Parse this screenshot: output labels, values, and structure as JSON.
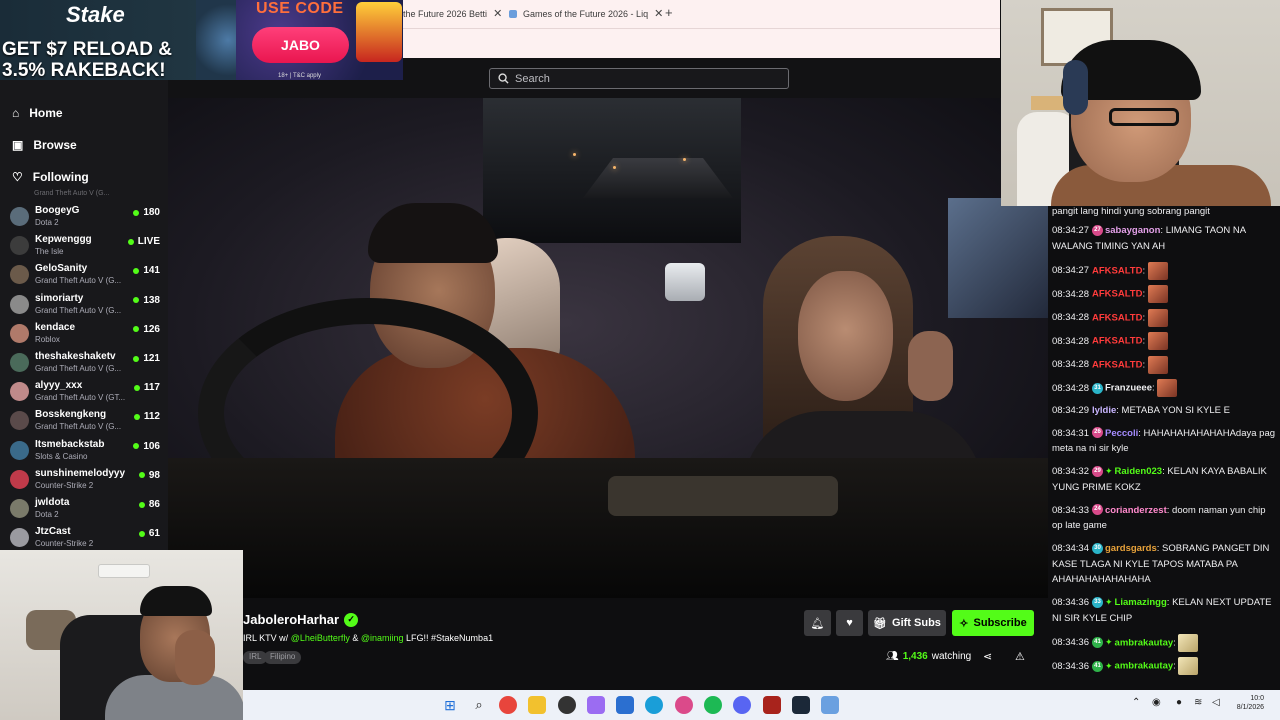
{
  "browser": {
    "tabs": [
      {
        "label": "the Future 2026 Betti"
      },
      {
        "label": "Games of the Future 2026 - Liq"
      }
    ]
  },
  "ad": {
    "brand": "Stake",
    "headline_line1": "GET $7 RELOAD &",
    "headline_line2": "3.5% RAKEBACK!",
    "use_code_label": "USE CODE",
    "code": "JABO",
    "fine_print": "18+ | T&C apply"
  },
  "search": {
    "placeholder": "Search"
  },
  "sidebar": {
    "nav": [
      {
        "label": "Home",
        "icon": "home-icon"
      },
      {
        "label": "Browse",
        "icon": "browse-icon"
      },
      {
        "label": "Following",
        "icon": "heart-icon"
      }
    ],
    "cut_text": "Grand Theft Auto V (G...",
    "channels": [
      {
        "name": "BoogeyG",
        "game": "Dota 2",
        "viewers": "180",
        "avatar_color": "#5a6c7a"
      },
      {
        "name": "Kepwenggg",
        "game": "The Isle",
        "viewers": "LIVE",
        "avatar_color": "#3c3c3c"
      },
      {
        "name": "GeloSanity",
        "game": "Grand Theft Auto V (G...",
        "viewers": "141",
        "avatar_color": "#6b5a4a"
      },
      {
        "name": "simoriarty",
        "game": "Grand Theft Auto V (G...",
        "viewers": "138",
        "avatar_color": "#8a8a8a"
      },
      {
        "name": "kendace",
        "game": "Roblox",
        "viewers": "126",
        "avatar_color": "#b07a6a"
      },
      {
        "name": "theshakeshaketv",
        "game": "Grand Theft Auto V (G...",
        "viewers": "121",
        "avatar_color": "#4a6a5a"
      },
      {
        "name": "alyyy_xxx",
        "game": "Grand Theft Auto V (GT...",
        "viewers": "117",
        "avatar_color": "#c08a8a"
      },
      {
        "name": "Bosskengkeng",
        "game": "Grand Theft Auto V (G...",
        "viewers": "112",
        "avatar_color": "#5a4a4a"
      },
      {
        "name": "Itsmebackstab",
        "game": "Slots & Casino",
        "viewers": "106",
        "avatar_color": "#3a6a8a"
      },
      {
        "name": "sunshinemelodyyy",
        "game": "Counter-Strike 2",
        "viewers": "98",
        "avatar_color": "#c03a4a"
      },
      {
        "name": "jwldota",
        "game": "Dota 2",
        "viewers": "86",
        "avatar_color": "#7a7a6a"
      },
      {
        "name": "JtzCast",
        "game": "Counter-Strike 2",
        "viewers": "61",
        "avatar_color": "#9a9aa0"
      }
    ]
  },
  "stream": {
    "streamer": "JaboleroHarhar",
    "title_prefix": "IRL KTV w/ ",
    "mention1": "@LheiButterfly",
    "title_mid": " & ",
    "mention2": "@inamiing",
    "title_suffix": " LFG!! #StakeNumba1",
    "tags": [
      "IRL",
      "Filipino"
    ],
    "gift_label": "Gift Subs",
    "subscribe_label": "Subscribe",
    "viewer_count": "1,436",
    "watching_label": "watching"
  },
  "chat": {
    "top_fragment": "pangit lang hindi yung sobrang pangit",
    "messages": [
      {
        "time": "08:34:27",
        "badge": "27",
        "badge_color": "#d84a8a",
        "diamond": false,
        "user": "sabayganon",
        "user_color": "#e3a0e8",
        "text": ": LIMANG TAON NA WALANG TIMING YAN AH",
        "emote": ""
      },
      {
        "time": "08:34:27",
        "badge": "",
        "badge_color": "",
        "diamond": false,
        "user": "AFKSALTD",
        "user_color": "#ff3b3b",
        "text": ":",
        "emote": "red"
      },
      {
        "time": "08:34:28",
        "badge": "",
        "badge_color": "",
        "diamond": false,
        "user": "AFKSALTD",
        "user_color": "#ff3b3b",
        "text": ":",
        "emote": "red"
      },
      {
        "time": "08:34:28",
        "badge": "",
        "badge_color": "",
        "diamond": false,
        "user": "AFKSALTD",
        "user_color": "#ff3b3b",
        "text": ":",
        "emote": "red"
      },
      {
        "time": "08:34:28",
        "badge": "",
        "badge_color": "",
        "diamond": false,
        "user": "AFKSALTD",
        "user_color": "#ff3b3b",
        "text": ":",
        "emote": "red"
      },
      {
        "time": "08:34:28",
        "badge": "",
        "badge_color": "",
        "diamond": false,
        "user": "AFKSALTD",
        "user_color": "#ff3b3b",
        "text": ":",
        "emote": "red"
      },
      {
        "time": "08:34:28",
        "badge": "31",
        "badge_color": "#2ab4c8",
        "diamond": false,
        "user": "Franzueee",
        "user_color": "#efeff1",
        "text": ":",
        "emote": "red"
      },
      {
        "time": "08:34:29",
        "badge": "",
        "badge_color": "",
        "diamond": false,
        "user": "lyldie",
        "user_color": "#c9b6ff",
        "text": ": METABA YON SI KYLE E",
        "emote": ""
      },
      {
        "time": "08:34:31",
        "badge": "26",
        "badge_color": "#d84a8a",
        "diamond": false,
        "user": "Peccoli",
        "user_color": "#a58cff",
        "text": ": HAHAHAHAHAHAHAdaya pag meta na ni sir kyle",
        "emote": ""
      },
      {
        "time": "08:34:32",
        "badge": "29",
        "badge_color": "#d84a8a",
        "diamond": true,
        "user": "Raiden023",
        "user_color": "#53fc18",
        "text": ": KELAN KAYA BABALIK YUNG PRIME KOKZ",
        "emote": ""
      },
      {
        "time": "08:34:33",
        "badge": "24",
        "badge_color": "#d84a8a",
        "diamond": false,
        "user": "corianderzest",
        "user_color": "#ff8acd",
        "text": ": doom naman yun chip op late game",
        "emote": ""
      },
      {
        "time": "08:34:34",
        "badge": "30",
        "badge_color": "#2ab4c8",
        "diamond": false,
        "user": "gardsgards",
        "user_color": "#e8a23a",
        "text": ": SOBRANG PANGET DIN KASE TLAGA NI KYLE TAPOS MATABA PA AHAHAHAHAHAHAHA",
        "emote": ""
      },
      {
        "time": "08:34:36",
        "badge": "33",
        "badge_color": "#2ab4c8",
        "diamond": true,
        "user": "Liamazingg",
        "user_color": "#53fc18",
        "text": ": KELAN NEXT UPDATE NI SIR KYLE CHIP",
        "emote": ""
      },
      {
        "time": "08:34:36",
        "badge": "41",
        "badge_color": "#2fb34a",
        "diamond": true,
        "user": "ambrakautay",
        "user_color": "#53fc18",
        "text": ":",
        "emote": "yellow"
      },
      {
        "time": "08:34:36",
        "badge": "41",
        "badge_color": "#2fb34a",
        "diamond": true,
        "user": "ambrakautay",
        "user_color": "#53fc18",
        "text": ":",
        "emote": "yellow"
      }
    ]
  },
  "taskbar": {
    "clock_time": "10:0",
    "clock_date": "8/1/2026"
  },
  "colors": {
    "accent": "#53fc18",
    "bg": "#0e0e10",
    "sidebar": "#18181b"
  }
}
